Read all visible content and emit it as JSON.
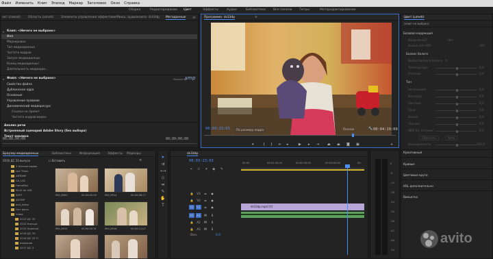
{
  "menu": [
    "Файл",
    "Изменить",
    "Клип",
    "Эпизод",
    "Маркер",
    "Заголовок",
    "Окно",
    "Справка"
  ],
  "workspaces": [
    "Сборка",
    "Редактирование",
    "Цвет",
    "Эффекты",
    "Аудио",
    "Библиотеки",
    "Все панели",
    "Титры",
    "Метаредактирование"
  ],
  "left_tabs": [
    "ект (самой)",
    "Область Lumetri",
    "Элементы управления эффектами",
    "Микш. аудиоклипа: ds33dp",
    "Метаданные"
  ],
  "metadata": {
    "clip_header": "Клип: <Ничего не выбрано>",
    "clip_rows": [
      "Имя",
      "Маркировка",
      "Тип медиаданных",
      "Частота кадров",
      "Запуск медиаданных",
      "Конец медиаданных",
      "Длительность медиадан..."
    ],
    "file_header": "Файл: <Ничего не выбрано>",
    "file_rows": [
      "Свойства файла",
      "Дублинское ядро",
      "Основные",
      "Управление правами",
      "Динамический медиаресурс"
    ],
    "file_sub": [
      "Ссылка на проект",
      "Частота кадров видео"
    ],
    "powered_by": "Powered By",
    "xmp": "xmp",
    "speech": "Анализ речи",
    "script": "Встроенный сценарий Adobe Story (без выбора)",
    "script_text": "Текст анализа",
    "tc_left": "00;00;00;00",
    "tc_right": "00;00;00;00"
  },
  "program": {
    "title": "Программа: ds33dp",
    "timecode": "00:03:23:03",
    "fit": "По размеру кадра",
    "quality": "Полное",
    "duration": "00:04:19:09",
    "menu_icon": "≡"
  },
  "lumetri": {
    "title": "Цвет Lumetri",
    "clip": "(клип не выбран)",
    "basic": "Базовая коррекция",
    "input_lut": "Входной LUT",
    "input_lut_val": "Нет",
    "hdr_white": "Белый для HDR",
    "hdr_white_val": "100",
    "white_balance": "Баланс белого",
    "wb_selector": "Выбор баланса белого",
    "temperature": "Температура",
    "tint": "Оттенок",
    "tone": "Тон",
    "exposure": "Экспозиция",
    "contrast": "Контраст",
    "highlights": "Светлые",
    "shadows": "Тени",
    "whites": "Белые",
    "blacks": "Черные",
    "hdr_specular": "HDR бл. оттенки",
    "reset": "Сбросить",
    "auto": "Авто",
    "saturation": "Насыщенность",
    "zero": "0,0",
    "hundred": "100,0",
    "sections": [
      "Креативный",
      "Кривые",
      "Цветовые круги",
      "HSL дополнительно",
      "Виньетка"
    ]
  },
  "browser": {
    "tabs": [
      "Браузер медиаданных",
      "Библиотеки",
      "Информация",
      "Эффекты",
      "Маркеры"
    ],
    "path": "2016 ДС 33 выпуск",
    "ingest": "Вставить",
    "folders": [
      "1 Ночное видео",
      "Lee Тёма",
      "ARTDNP",
      "CA_LSC",
      "HomeBoz",
      "Mul2 for VID",
      "SOFT",
      "DOTNP",
      "dvd_temp",
      "Нет фото",
      "Video",
      "2013 ДС 33",
      "2015 Кольца",
      "2015 Solemnit",
      "2016 ДС 33",
      "2016 ДС 33 П",
      "конышев",
      "2017 ДС 3"
    ],
    "clips": [
      {
        "name": "MVI_6900",
        "dur": "00:00:00:09"
      },
      {
        "name": "MVI_6914",
        "dur": "00:00:06:17"
      },
      {
        "name": "MVI_6915",
        "dur": "00:00:05:21"
      },
      {
        "name": "MVI_6916",
        "dur": "00:00:11:07"
      }
    ]
  },
  "timeline": {
    "title": "ds33dp",
    "timecode": "00:03:23:03",
    "ruler": [
      "00:00",
      "00:01:00:00",
      "00:02:00:00",
      "00:03:00:00",
      "00:"
    ],
    "video_tracks": [
      "V3",
      "V2",
      "V1"
    ],
    "audio_tracks": [
      "A1",
      "A2",
      "A3"
    ],
    "clip_label": "ds33dp.mp4 [V]",
    "master": "Осн.",
    "master_val": "0,0",
    "meter_db": [
      "0",
      "-6",
      "-12",
      "-18",
      "-24",
      "-30",
      "-36",
      "-42",
      "-48",
      "-54"
    ]
  },
  "watermark": "avito",
  "colors": {
    "accent": "#4d8ef0",
    "v1_clip": "#b9a6d8",
    "audio_clip": "#5ea05e",
    "playhead": "#4d8ef0"
  }
}
